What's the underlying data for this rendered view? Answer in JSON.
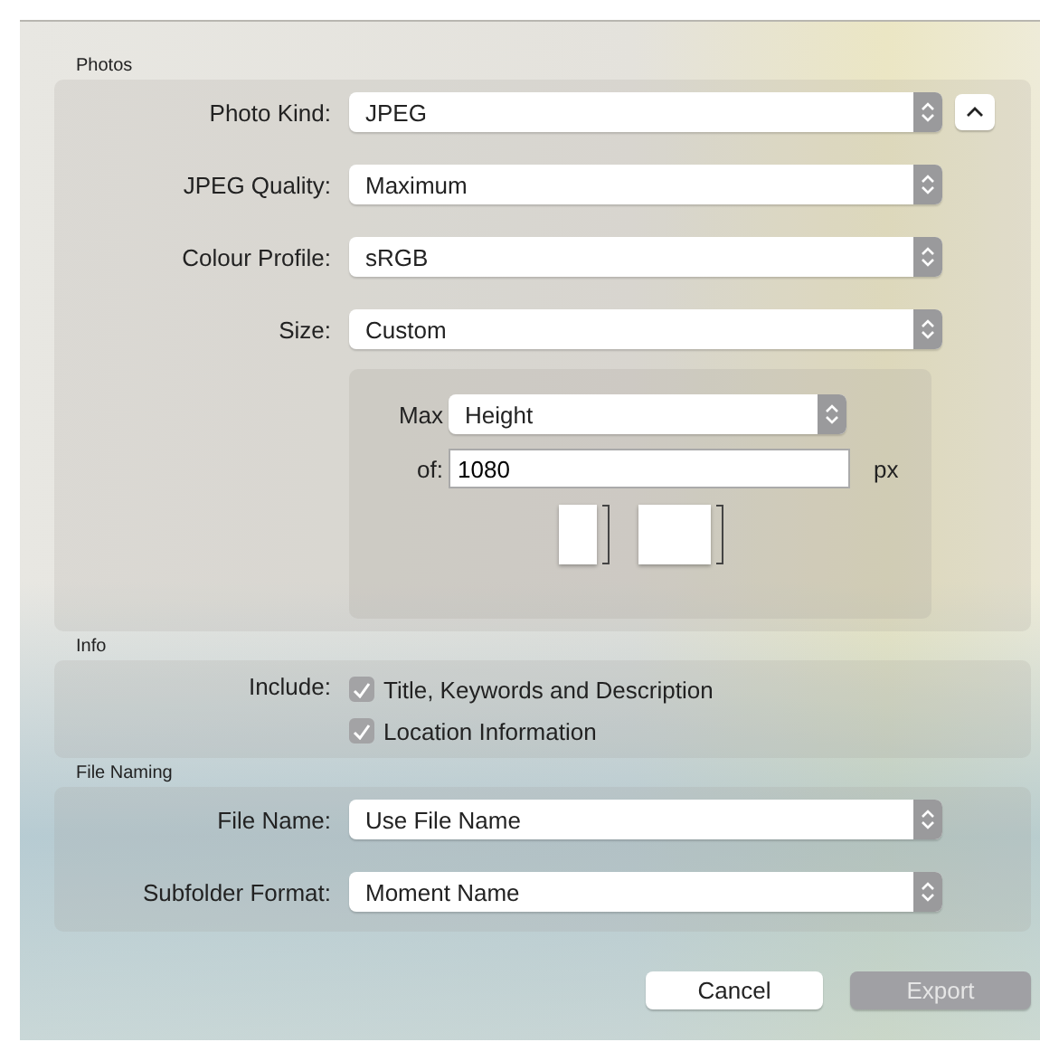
{
  "sections": [
    {
      "kind": "popups",
      "title": "Photos",
      "rows": [
        {
          "label": "Photo Kind:",
          "value": "JPEG",
          "collapse": true
        },
        {
          "label": "JPEG Quality:",
          "value": "Maximum"
        },
        {
          "label": "Colour Profile:",
          "value": "sRGB"
        },
        {
          "label": "Size:",
          "value": "Custom"
        }
      ],
      "size": {
        "max_label": "Max",
        "max_value": "Height",
        "of_label": "of:",
        "of_value": "1080",
        "unit": "px"
      }
    },
    {
      "kind": "checks",
      "title": "Info",
      "label": "Include:",
      "checks": [
        {
          "label": "Title, Keywords and Description",
          "checked": true
        },
        {
          "label": "Location Information",
          "checked": true
        }
      ]
    },
    {
      "kind": "popups",
      "title": "File Naming",
      "rows": [
        {
          "label": "File Name:",
          "value": "Use File Name"
        },
        {
          "label": "Subfolder Format:",
          "value": "Moment Name"
        }
      ]
    }
  ],
  "buttons": [
    {
      "label": "Cancel",
      "disabled": false
    },
    {
      "label": "Export",
      "disabled": true
    }
  ]
}
